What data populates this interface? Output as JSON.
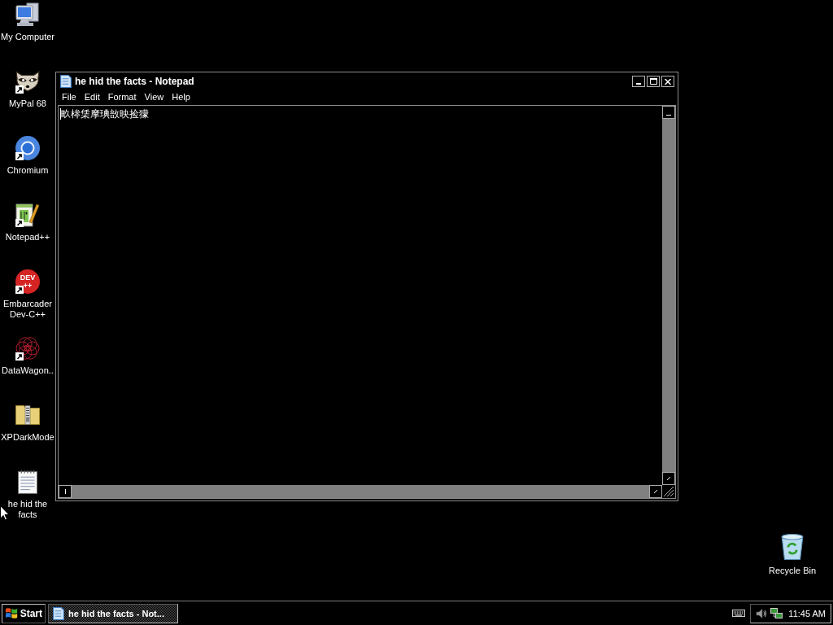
{
  "desktop": {
    "icons": [
      {
        "label": "My Computer",
        "shortcut": false
      },
      {
        "label": "MyPal 68",
        "shortcut": true
      },
      {
        "label": "Chromium",
        "shortcut": true
      },
      {
        "label": "Notepad++",
        "shortcut": true
      },
      {
        "label": "Embarcader Dev-C++",
        "shortcut": true,
        "logo_text": [
          "DEV",
          "++"
        ]
      },
      {
        "label": "DataWagon..",
        "shortcut": true
      },
      {
        "label": "XPDarkMode",
        "shortcut": false
      },
      {
        "label": "he hid the facts",
        "shortcut": false
      }
    ],
    "recycle_bin": {
      "label": "Recycle Bin"
    }
  },
  "notepad": {
    "title": "he hid the facts - Notepad",
    "menu": [
      "File",
      "Edit",
      "Format",
      "View",
      "Help"
    ],
    "text": "畂桳栠摩琠敨映捡獴"
  },
  "taskbar": {
    "start": "Start",
    "tasks": [
      {
        "label": "he hid the facts - Not...",
        "selected": true
      }
    ],
    "clock": "11:45 AM"
  }
}
